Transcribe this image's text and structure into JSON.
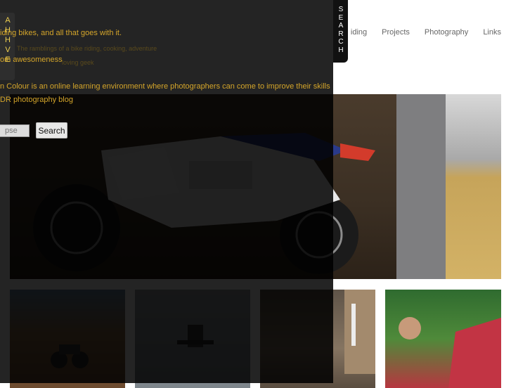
{
  "nav": {
    "items": [
      {
        "label": "iding"
      },
      {
        "label": "Projects"
      },
      {
        "label": "Photography"
      },
      {
        "label": "Links"
      }
    ]
  },
  "overlay": {
    "strip_letters": "AHHVE",
    "results": {
      "r1": "iding bikes, and all that goes with it.",
      "r2": "The ramblings of a bike riding, cooking, adventure",
      "r3": "om awesomeness",
      "r3b": "loving geek",
      "r4": "n Colour is an online learning environment where photographers can come to improve their skills",
      "r5a": "DR photography",
      "r5b": " blog"
    },
    "search": {
      "value": "",
      "placeholder": "pse",
      "button_label": "Search"
    },
    "tab_label": "SEARCH"
  },
  "colors": {
    "overlay": "#000000",
    "result_text": "#d4a52a",
    "tab": "#111111"
  }
}
